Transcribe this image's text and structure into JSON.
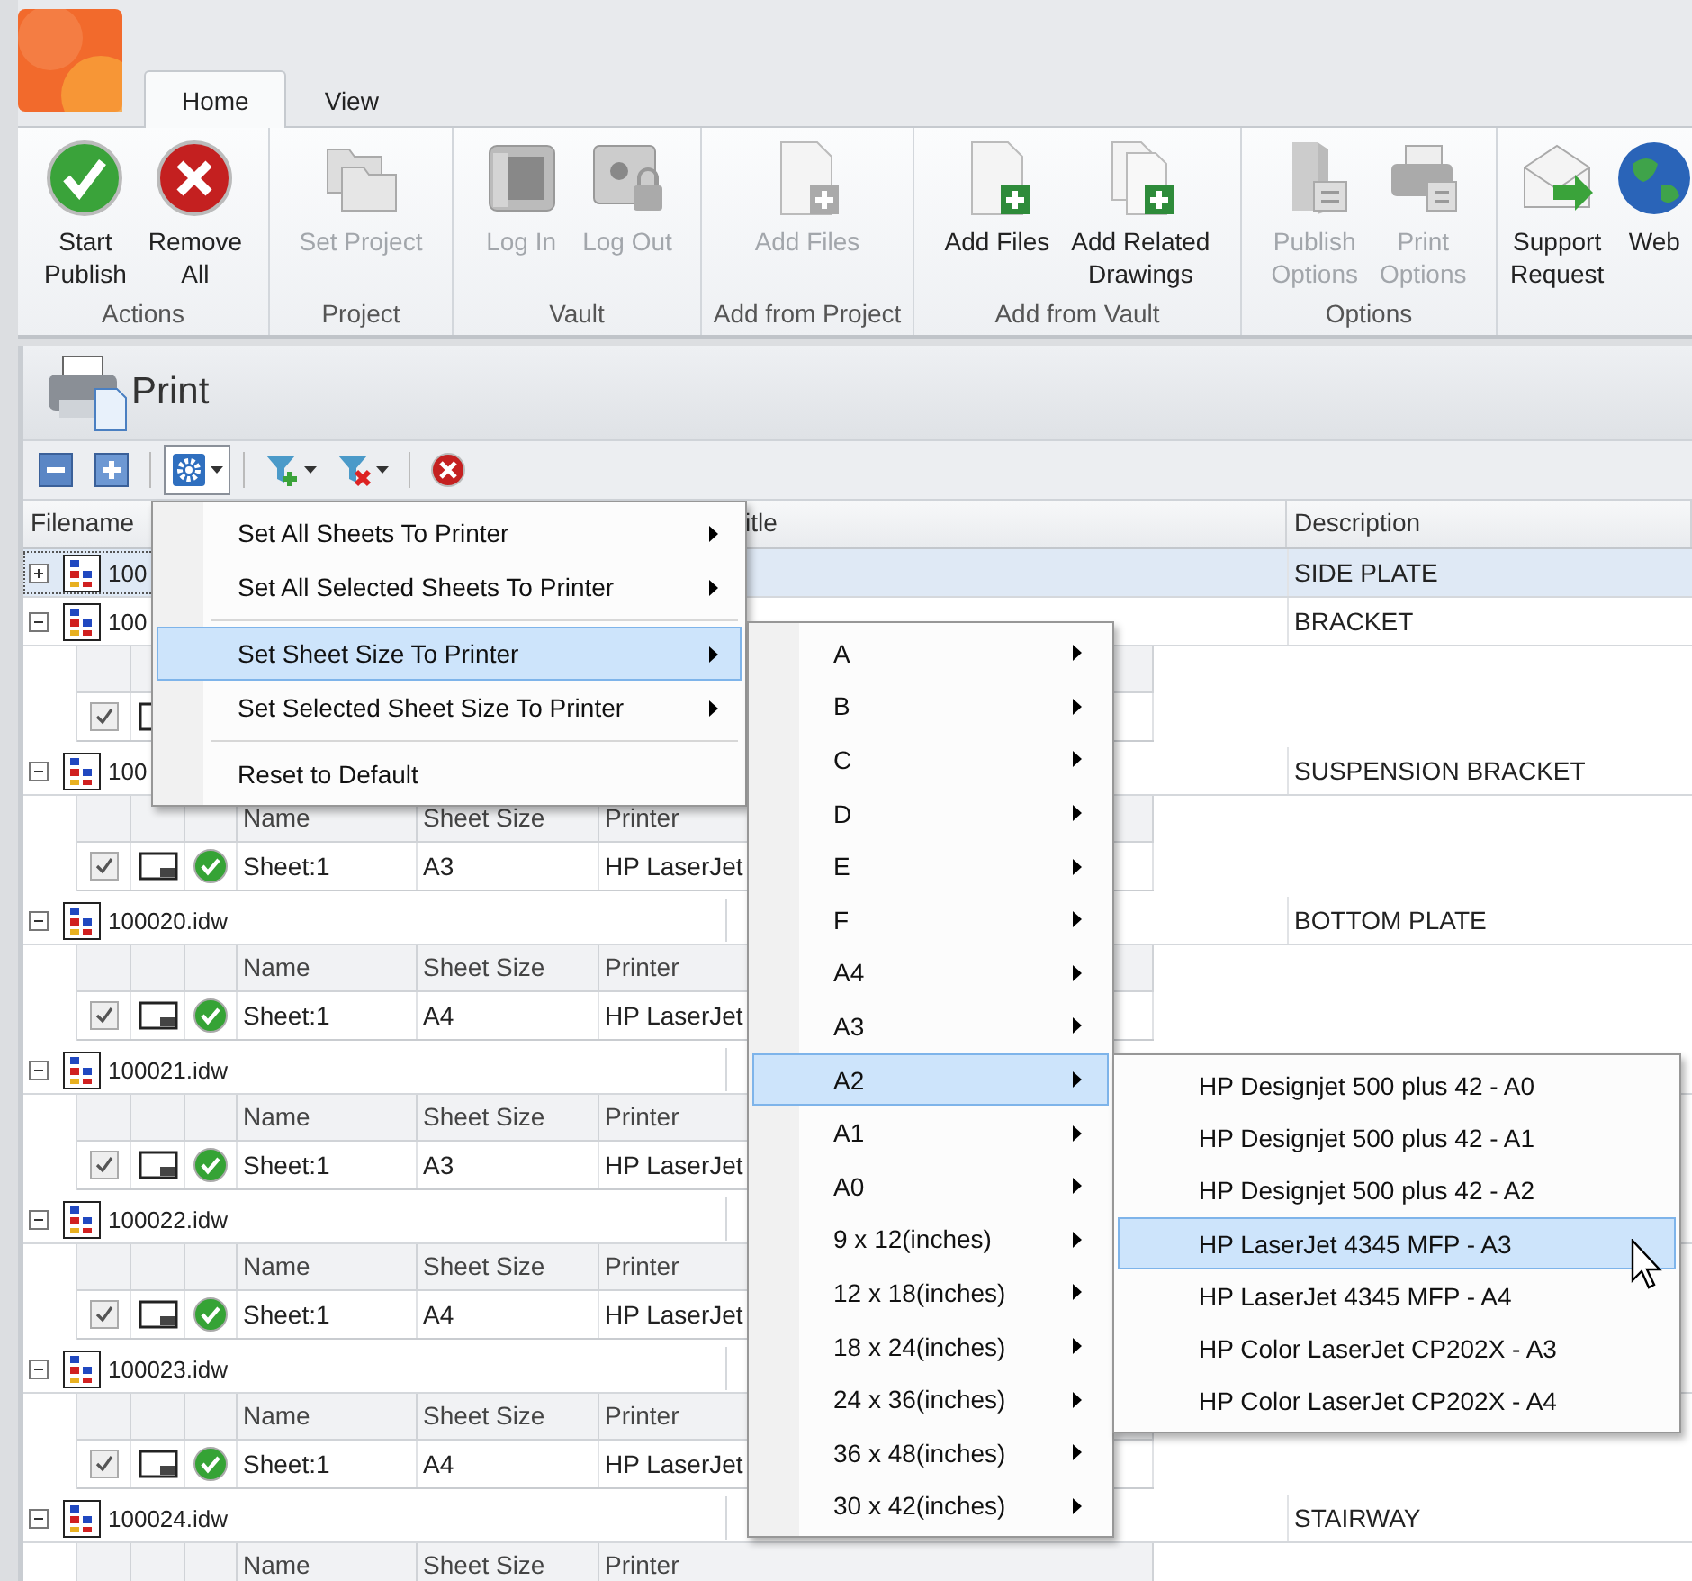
{
  "tabs": [
    {
      "label": "Home",
      "selected": true
    },
    {
      "label": "View",
      "selected": false
    }
  ],
  "ribbon": {
    "groups": [
      {
        "label": "Actions",
        "buttons": [
          {
            "lines": [
              "Start",
              "Publish"
            ],
            "kind": "check",
            "disabled": false
          },
          {
            "lines": [
              "Remove",
              "All"
            ],
            "kind": "remove",
            "disabled": false
          }
        ]
      },
      {
        "label": "Project",
        "buttons": [
          {
            "lines": [
              "Set Project"
            ],
            "kind": "folders",
            "disabled": true
          }
        ]
      },
      {
        "label": "Vault",
        "buttons": [
          {
            "lines": [
              "Log In"
            ],
            "kind": "login",
            "disabled": true
          },
          {
            "lines": [
              "Log Out"
            ],
            "kind": "logout",
            "disabled": true
          }
        ]
      },
      {
        "label": "Add from Project",
        "buttons": [
          {
            "lines": [
              "Add Files"
            ],
            "kind": "add-file",
            "disabled": true
          }
        ]
      },
      {
        "label": "Add from Vault",
        "buttons": [
          {
            "lines": [
              "Add Files"
            ],
            "kind": "add-file",
            "disabled": false
          },
          {
            "lines": [
              "Add Related",
              "Drawings"
            ],
            "kind": "add-related",
            "disabled": false
          }
        ]
      },
      {
        "label": "Options",
        "buttons": [
          {
            "lines": [
              "Publish",
              "Options"
            ],
            "kind": "publish-options",
            "disabled": true
          },
          {
            "lines": [
              "Print",
              "Options"
            ],
            "kind": "print-options",
            "disabled": true
          }
        ]
      },
      {
        "buttons": [
          {
            "lines": [
              "Support",
              "Request"
            ],
            "kind": "mail",
            "disabled": false
          },
          {
            "lines": [
              "Web"
            ],
            "kind": "globe",
            "disabled": false
          }
        ]
      }
    ]
  },
  "panel": {
    "title": "Print"
  },
  "toolbar": [
    {
      "kind": "collapse"
    },
    {
      "kind": "expand"
    },
    {
      "kind": "settings",
      "pressed": true
    },
    {
      "kind": "filter-add",
      "pressed": false
    },
    {
      "kind": "filter-remove",
      "pressed": false
    },
    {
      "kind": "stop"
    }
  ],
  "grid": {
    "columns": [
      "Filename",
      "itle",
      "Description"
    ],
    "files": [
      {
        "name": "100",
        "description": "SIDE PLATE",
        "expanded": false,
        "selected": true
      },
      {
        "name": "100",
        "description": "BRACKET",
        "expanded": true,
        "selected": false,
        "sheets": [
          {
            "checked": true
          }
        ]
      },
      {
        "name": "100",
        "description": "SUSPENSION BRACKET",
        "expanded": true,
        "selected": false,
        "sheet_columns": [
          "Name",
          "Sheet Size",
          "Printer"
        ],
        "sheets": [
          {
            "checked": true,
            "name": "Sheet:1",
            "size": "A3",
            "printer": "HP LaserJet"
          }
        ]
      },
      {
        "name": "100020.idw",
        "description": "BOTTOM PLATE",
        "expanded": true,
        "selected": false,
        "sheet_columns": [
          "Name",
          "Sheet Size",
          "Printer"
        ],
        "sheets": [
          {
            "checked": true,
            "name": "Sheet:1",
            "size": "A4",
            "printer": "HP LaserJet"
          }
        ]
      },
      {
        "name": "100021.idw",
        "expanded": true,
        "selected": false,
        "sheet_columns": [
          "Name",
          "Sheet Size",
          "Printer"
        ],
        "sheets": [
          {
            "checked": true,
            "name": "Sheet:1",
            "size": "A3",
            "printer": "HP LaserJet"
          }
        ]
      },
      {
        "name": "100022.idw",
        "expanded": true,
        "selected": false,
        "sheet_columns": [
          "Name",
          "Sheet Size",
          "Printer"
        ],
        "sheets": [
          {
            "checked": true,
            "name": "Sheet:1",
            "size": "A4",
            "printer": "HP LaserJet"
          }
        ]
      },
      {
        "name": "100023.idw",
        "expanded": true,
        "selected": false,
        "sheet_columns": [
          "Name",
          "Sheet Size",
          "Printer"
        ],
        "sheets": [
          {
            "checked": true,
            "name": "Sheet:1",
            "size": "A4",
            "printer": "HP LaserJet"
          }
        ]
      },
      {
        "name": "100024.idw",
        "description": "STAIRWAY",
        "expanded": true,
        "selected": false,
        "sheet_columns": [
          "Name",
          "Sheet Size",
          "Printer"
        ]
      }
    ]
  },
  "context_menu": {
    "items": [
      {
        "kind": "item",
        "label": "Set All Sheets To Printer",
        "submenu": true,
        "selected": false
      },
      {
        "kind": "item",
        "label": "Set All Selected Sheets To Printer",
        "submenu": true,
        "selected": false
      },
      {
        "kind": "separator"
      },
      {
        "kind": "item",
        "label": "Set Sheet Size To Printer",
        "submenu": true,
        "selected": true
      },
      {
        "kind": "item",
        "label": "Set Selected Sheet Size To Printer",
        "submenu": true,
        "selected": false
      },
      {
        "kind": "separator"
      },
      {
        "kind": "item",
        "label": "Reset to Default",
        "submenu": false,
        "selected": false
      }
    ]
  },
  "size_menu": {
    "items": [
      {
        "label": "A",
        "selected": false
      },
      {
        "label": "B",
        "selected": false
      },
      {
        "label": "C",
        "selected": false
      },
      {
        "label": "D",
        "selected": false
      },
      {
        "label": "E",
        "selected": false
      },
      {
        "label": "F",
        "selected": false
      },
      {
        "label": "A4",
        "selected": false
      },
      {
        "label": "A3",
        "selected": false
      },
      {
        "label": "A2",
        "selected": true
      },
      {
        "label": "A1",
        "selected": false
      },
      {
        "label": "A0",
        "selected": false
      },
      {
        "label": "9 x 12(inches)",
        "selected": false
      },
      {
        "label": "12 x 18(inches)",
        "selected": false
      },
      {
        "label": "18 x 24(inches)",
        "selected": false
      },
      {
        "label": "24 x 36(inches)",
        "selected": false
      },
      {
        "label": "36 x 48(inches)",
        "selected": false
      },
      {
        "label": "30 x 42(inches)",
        "selected": false
      }
    ]
  },
  "printer_menu": {
    "items": [
      {
        "label": "HP Designjet 500 plus 42 - A0",
        "selected": false
      },
      {
        "label": "HP Designjet 500 plus 42 - A1",
        "selected": false
      },
      {
        "label": "HP Designjet 500 plus 42 - A2",
        "selected": false
      },
      {
        "label": "HP LaserJet 4345 MFP - A3",
        "selected": true
      },
      {
        "label": "HP LaserJet 4345 MFP - A4",
        "selected": false
      },
      {
        "label": "HP Color LaserJet CP202X - A3",
        "selected": false
      },
      {
        "label": "HP Color LaserJet CP202X - A4",
        "selected": false
      }
    ]
  }
}
